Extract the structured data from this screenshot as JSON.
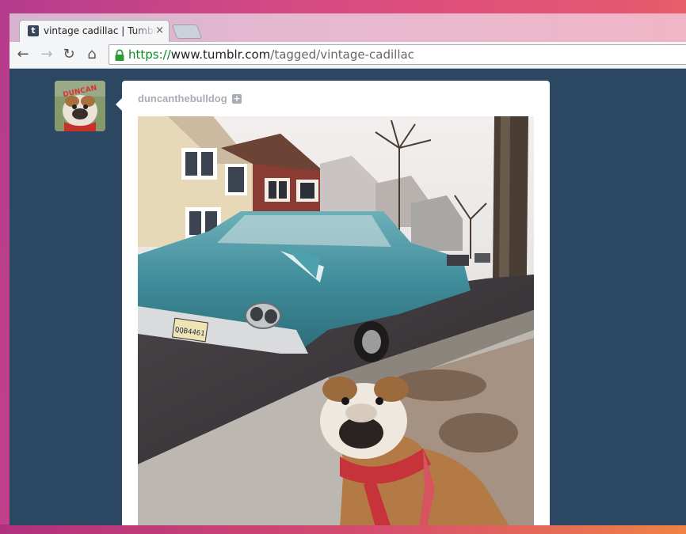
{
  "browser": {
    "tab": {
      "favicon": "t",
      "title": "vintage cadillac | Tumblr",
      "close": "×"
    },
    "url": {
      "scheme": "https://",
      "host": "www.tumblr.com",
      "path": "/tagged/vintage-cadillac"
    },
    "nav": {
      "back": "←",
      "forward": "→",
      "reload": "↻",
      "home": "⌂"
    }
  },
  "post": {
    "author": "duncanthebulldog",
    "follow": "+",
    "avatar_text": "DUNCAN",
    "license_plate": "QQB4461"
  },
  "colors": {
    "page_bg": "#2c4762",
    "car": "#3f8c9a",
    "sky": "#e8e4e6"
  }
}
